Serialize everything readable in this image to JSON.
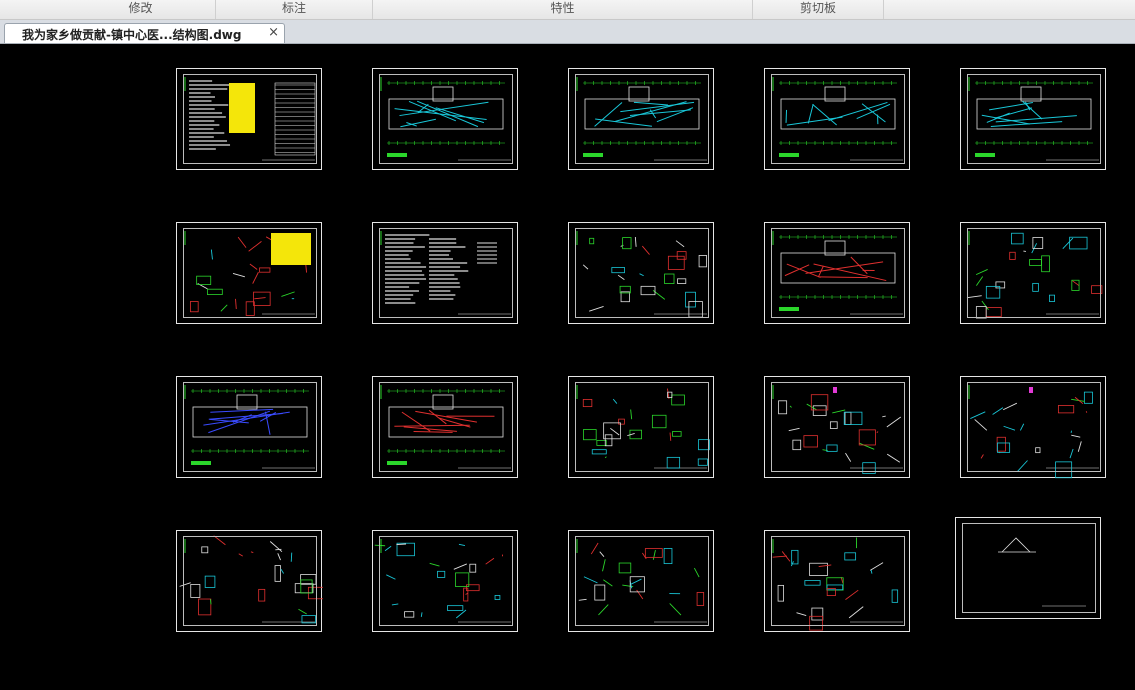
{
  "ribbon": {
    "groups": [
      {
        "label": "修改"
      },
      {
        "label": "标注"
      },
      {
        "label": "特性"
      },
      {
        "label": "剪切板"
      }
    ]
  },
  "document_tab": {
    "title": "我为家乡做贡献-镇中心医...结构图.dwg",
    "close_glyph": "×"
  },
  "canvas": {
    "background": "#000000",
    "sheet_count": 20,
    "sheet_colors": {
      "frame": "#e6e6e6",
      "lines_green": "#2bd62b",
      "lines_white": "#e0e0e0",
      "lines_red": "#e0302f",
      "lines_cyan": "#19c7d8",
      "lines_blue": "#3a4bff",
      "fill_yellow": "#f4e60a",
      "accent_magenta": "#e23ad6"
    }
  }
}
